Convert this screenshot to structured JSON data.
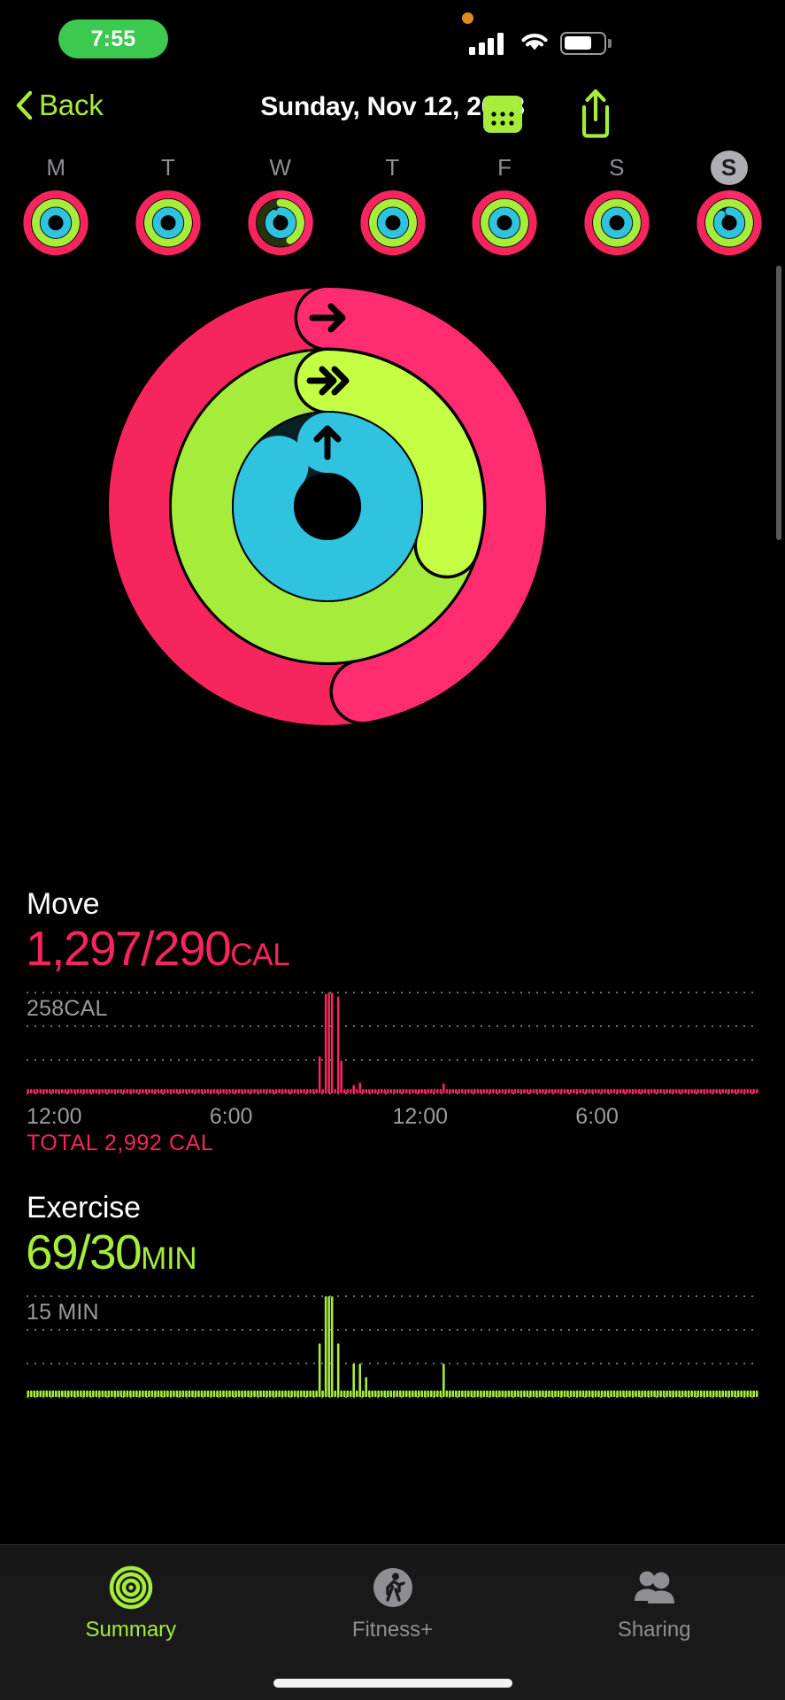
{
  "status_bar": {
    "time": "7:55",
    "cellular_icon": "cellular-bars-icon",
    "wifi_icon": "wifi-icon",
    "battery_icon": "battery-icon",
    "recording_indicator": "orange-privacy-dot"
  },
  "nav_bar": {
    "back_label": "Back",
    "title": "Sunday, Nov 12, 2023",
    "calendar_icon": "calendar-icon",
    "share_icon": "share-icon",
    "accent_color": "#a6ec3a"
  },
  "week_strip": {
    "days": [
      {
        "letter": "M",
        "selected": false,
        "move": 1.0,
        "exercise": 1.0,
        "stand": 1.0
      },
      {
        "letter": "T",
        "selected": false,
        "move": 1.0,
        "exercise": 1.0,
        "stand": 1.0
      },
      {
        "letter": "W",
        "selected": false,
        "move": 1.35,
        "exercise": 0.42,
        "stand": 0.9
      },
      {
        "letter": "T",
        "selected": false,
        "move": 1.0,
        "exercise": 1.0,
        "stand": 1.0
      },
      {
        "letter": "F",
        "selected": false,
        "move": 1.0,
        "exercise": 1.0,
        "stand": 1.0
      },
      {
        "letter": "S",
        "selected": false,
        "move": 1.0,
        "exercise": 1.0,
        "stand": 1.0
      },
      {
        "letter": "S",
        "selected": true,
        "move": 1.15,
        "exercise": 1.0,
        "stand": 0.88
      }
    ]
  },
  "rings": {
    "move_color": "#f6255e",
    "exercise_color": "#a6ec3a",
    "stand_color": "#2fc3e0",
    "move_progress": 4.47,
    "exercise_progress": 2.3,
    "stand_progress": 0.86,
    "move_arrow_icon": "arrow-right-icon",
    "exercise_arrow_icon": "double-arrow-right-icon",
    "stand_arrow_icon": "arrow-up-icon"
  },
  "move": {
    "title": "Move",
    "value": "1,297/290",
    "unit": "CAL",
    "color": "#f6255e",
    "axis_max_label": "258CAL",
    "total_label": "TOTAL 2,992 CAL",
    "x_ticks": [
      "12:00",
      "6:00",
      "12:00",
      "6:00"
    ]
  },
  "exercise": {
    "title": "Exercise",
    "value": "69/30",
    "unit": "MIN",
    "color": "#a6ec3a",
    "axis_max_label": "15 MIN"
  },
  "tab_bar": {
    "tabs": [
      {
        "label": "Summary",
        "icon": "activity-rings-icon",
        "active": true
      },
      {
        "label": "Fitness+",
        "icon": "running-person-icon",
        "active": false
      },
      {
        "label": "Sharing",
        "icon": "people-icon",
        "active": false
      }
    ]
  },
  "chart_data": [
    {
      "type": "bar",
      "id": "move-chart",
      "title": "Move",
      "ylabel": "CAL",
      "xlabel": "",
      "ylim": [
        0,
        258
      ],
      "axis_max_label": "258CAL",
      "grid": true,
      "x_ticks": [
        "12:00",
        "6:00",
        "12:00",
        "6:00"
      ],
      "x_tick_positions": [
        0,
        0.25,
        0.5,
        0.75
      ],
      "total": "TOTAL 2,992 CAL",
      "color": "#f6255e",
      "values": [
        3,
        3,
        3,
        3,
        3,
        3,
        3,
        3,
        3,
        3,
        3,
        3,
        3,
        3,
        3,
        3,
        3,
        3,
        3,
        3,
        3,
        3,
        3,
        3,
        3,
        3,
        3,
        3,
        3,
        3,
        3,
        3,
        3,
        3,
        3,
        3,
        3,
        3,
        3,
        3,
        3,
        3,
        3,
        3,
        3,
        3,
        3,
        3,
        3,
        3,
        3,
        3,
        3,
        3,
        3,
        3,
        3,
        3,
        3,
        3,
        3,
        3,
        3,
        3,
        3,
        3,
        3,
        3,
        3,
        3,
        3,
        3,
        3,
        3,
        3,
        3,
        3,
        3,
        3,
        3,
        3,
        3,
        3,
        3,
        3,
        3,
        3,
        3,
        3,
        3,
        3,
        3,
        3,
        3,
        95,
        3,
        255,
        258,
        258,
        3,
        248,
        85,
        3,
        3,
        10,
        22,
        8,
        28,
        10,
        6,
        6,
        8,
        10,
        6,
        5,
        4,
        4,
        4,
        4,
        4,
        4,
        4,
        4,
        4,
        4,
        4,
        4,
        4,
        4,
        4,
        4,
        4,
        4,
        4,
        26,
        4,
        4,
        4,
        4,
        4,
        4,
        4,
        4,
        4,
        4,
        4,
        4,
        4,
        4,
        4,
        4,
        4,
        4,
        4,
        4,
        4,
        4,
        4,
        4,
        4,
        4,
        4,
        4,
        4,
        4,
        4,
        4,
        4,
        4,
        4,
        4,
        4,
        4,
        4,
        4,
        4,
        4,
        4,
        4,
        4,
        4,
        4,
        4,
        4,
        4,
        4,
        4,
        4,
        4,
        4,
        4,
        4,
        4,
        4,
        4,
        4,
        4,
        4,
        4,
        4,
        4,
        4,
        4,
        4,
        4,
        4,
        4,
        4,
        4,
        4,
        4,
        4,
        4,
        4,
        4,
        4,
        4,
        4,
        4,
        4,
        4,
        4,
        4,
        4,
        4,
        4,
        4,
        4,
        4,
        4,
        4,
        4,
        4,
        4,
        4,
        4
      ]
    },
    {
      "type": "bar",
      "id": "exercise-chart",
      "title": "Exercise",
      "ylabel": "MIN",
      "xlabel": "",
      "ylim": [
        0,
        15
      ],
      "axis_max_label": "15 MIN",
      "grid": true,
      "color": "#a6ec3a",
      "values": [
        1,
        1,
        1,
        1,
        1,
        1,
        1,
        1,
        1,
        1,
        1,
        1,
        1,
        1,
        1,
        1,
        1,
        1,
        1,
        1,
        1,
        1,
        1,
        1,
        1,
        1,
        1,
        1,
        1,
        1,
        1,
        1,
        1,
        1,
        1,
        1,
        1,
        1,
        1,
        1,
        1,
        1,
        1,
        1,
        1,
        1,
        1,
        1,
        1,
        1,
        1,
        1,
        1,
        1,
        1,
        1,
        1,
        1,
        1,
        1,
        1,
        1,
        1,
        1,
        1,
        1,
        1,
        1,
        1,
        1,
        1,
        1,
        1,
        1,
        1,
        1,
        1,
        1,
        1,
        1,
        1,
        1,
        1,
        1,
        1,
        1,
        1,
        1,
        1,
        1,
        1,
        1,
        1,
        1,
        8,
        1,
        15,
        15,
        15,
        1,
        8,
        1,
        1,
        1,
        1,
        5,
        1,
        5,
        1,
        3,
        1,
        1,
        1,
        1,
        1,
        1,
        1,
        1,
        1,
        1,
        1,
        1,
        1,
        1,
        1,
        1,
        1,
        1,
        1,
        1,
        1,
        1,
        1,
        1,
        5,
        1,
        1,
        1,
        1,
        1,
        1,
        1,
        1,
        1,
        1,
        1,
        1,
        1,
        1,
        1,
        1,
        1,
        1,
        1,
        1,
        1,
        1,
        1,
        1,
        1,
        1,
        1,
        1,
        1,
        1,
        1,
        1,
        1,
        1,
        1,
        1,
        1,
        1,
        1,
        1,
        1,
        1,
        1,
        1,
        1,
        1,
        1,
        1,
        1,
        1,
        1,
        1,
        1,
        1,
        1,
        1,
        1,
        1,
        1,
        1,
        1,
        1,
        1,
        1,
        1,
        1,
        1,
        1,
        1,
        1,
        1,
        1,
        1,
        1,
        1,
        1,
        1,
        1,
        1,
        1,
        1,
        1,
        1,
        1,
        1,
        1,
        1,
        1,
        1,
        1,
        1,
        1,
        1,
        1,
        1,
        1,
        1,
        1,
        1,
        1,
        1
      ]
    }
  ]
}
